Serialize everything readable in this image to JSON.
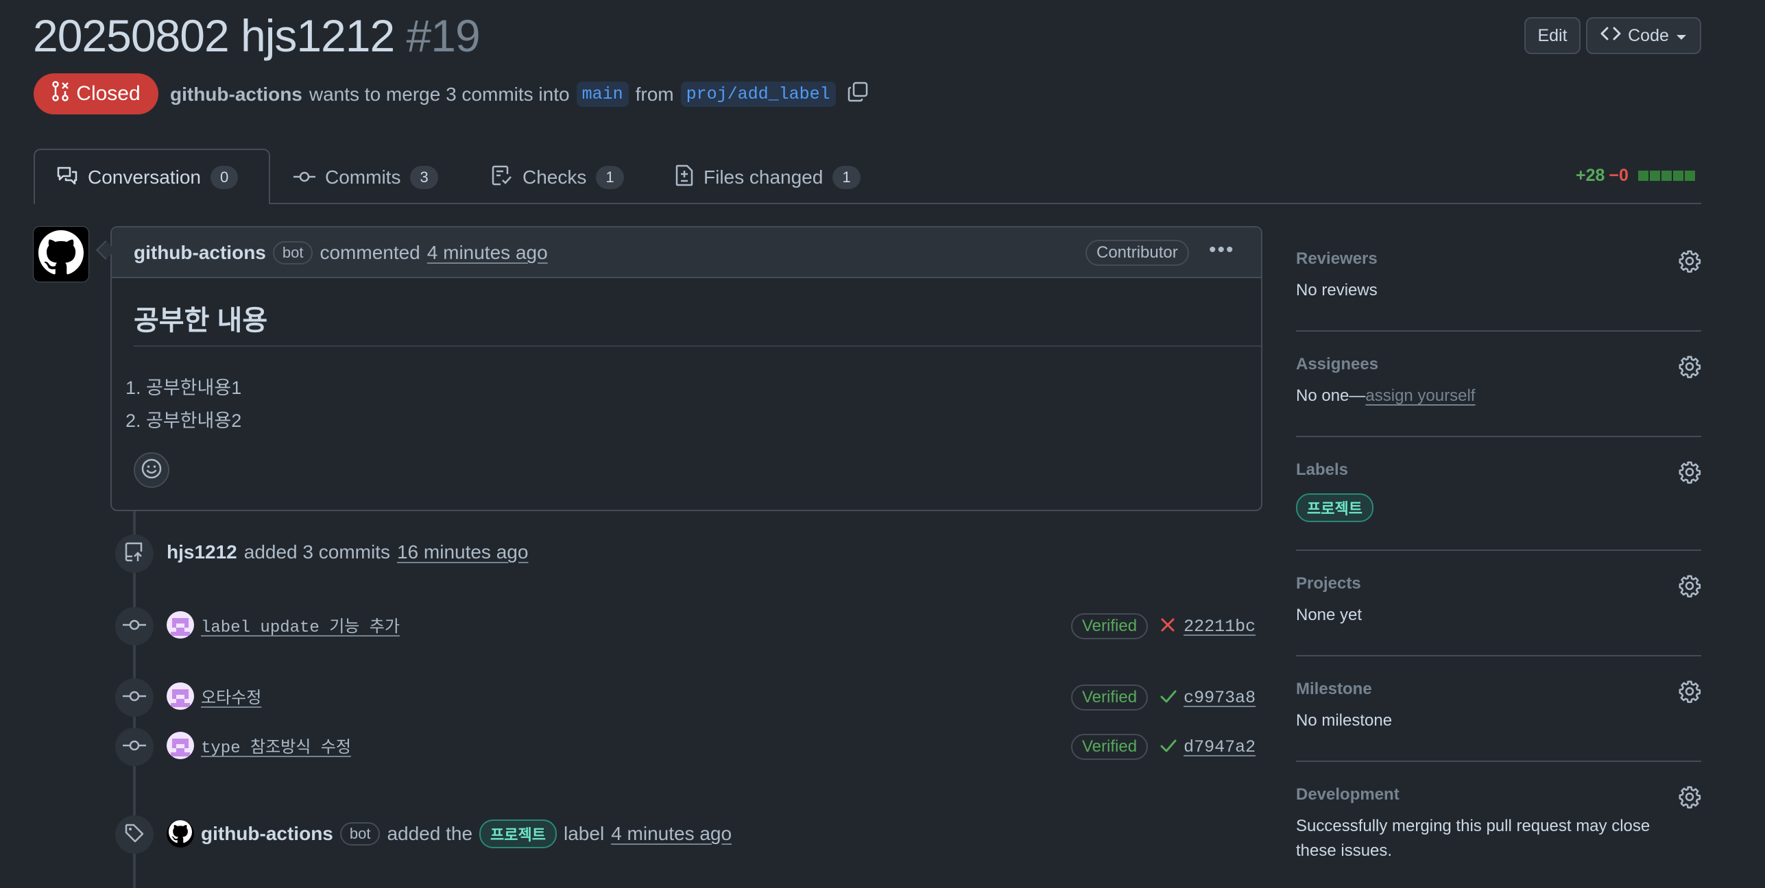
{
  "pr": {
    "title": "20250802 hjs1212",
    "number": "#19",
    "state": "Closed",
    "author": "github-actions",
    "merge_text": "wants to merge 3 commits into",
    "base_branch": "main",
    "from_text": "from",
    "head_branch": "proj/add_label"
  },
  "header_buttons": {
    "edit": "Edit",
    "code": "Code"
  },
  "tabs": [
    {
      "label": "Conversation",
      "count": "0"
    },
    {
      "label": "Commits",
      "count": "3"
    },
    {
      "label": "Checks",
      "count": "1"
    },
    {
      "label": "Files changed",
      "count": "1"
    }
  ],
  "diffstat": {
    "additions": "+28",
    "deletions": "−0"
  },
  "comment": {
    "author": "github-actions",
    "bot_label": "bot",
    "action": "commented",
    "time": "4 minutes ago",
    "role": "Contributor",
    "heading": "공부한 내용",
    "items": [
      "공부한내용1",
      "공부한내용2"
    ]
  },
  "timeline": {
    "push_event": {
      "author": "hjs1212",
      "text": "added 3 commits",
      "time": "16 minutes ago"
    },
    "commits": [
      {
        "message": "label update 기능 추가",
        "verified": "Verified",
        "status": "fail",
        "sha": "22211bc"
      },
      {
        "message": "오타수정",
        "verified": "Verified",
        "status": "success",
        "sha": "c9973a8"
      },
      {
        "message": "type 참조방식 수정",
        "verified": "Verified",
        "status": "success",
        "sha": "d7947a2"
      }
    ],
    "label_event": {
      "author": "github-actions",
      "bot_label": "bot",
      "text_before": "added the",
      "label": "프로젝트",
      "text_after": "label",
      "time": "4 minutes ago"
    }
  },
  "sidebar": {
    "reviewers": {
      "title": "Reviewers",
      "value": "No reviews"
    },
    "assignees": {
      "title": "Assignees",
      "value": "No one—",
      "link": "assign yourself"
    },
    "labels": {
      "title": "Labels",
      "label": "프로젝트"
    },
    "projects": {
      "title": "Projects",
      "value": "None yet"
    },
    "milestone": {
      "title": "Milestone",
      "value": "No milestone"
    },
    "development": {
      "title": "Development",
      "value": "Successfully merging this pull request may close these issues."
    }
  },
  "colors": {
    "closed": "#c93c37",
    "verified": "#57ab5a",
    "fail": "#e5534b",
    "label": "#2bcaa1"
  }
}
